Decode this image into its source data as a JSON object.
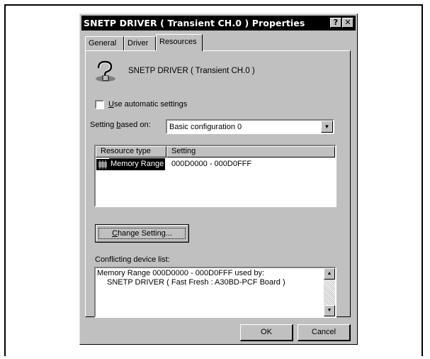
{
  "dialog": {
    "title": "SNETP DRIVER ( Transient CH.0 ) Properties",
    "help_label": "?",
    "close_label": "✕"
  },
  "tabs": [
    {
      "label": "General"
    },
    {
      "label": "Driver"
    },
    {
      "label": "Resources"
    }
  ],
  "device": {
    "icon": "unknown-device-icon",
    "name": "SNETP DRIVER ( Transient CH.0 )"
  },
  "auto_settings": {
    "label_hotkey": "U",
    "label_rest": "se automatic settings",
    "checked": false
  },
  "setting_based": {
    "label_prefix": "Setting ",
    "label_hotkey": "b",
    "label_rest": "ased on:",
    "value": "Basic configuration 0"
  },
  "resources": {
    "columns": [
      "Resource type",
      "Setting"
    ],
    "rows": [
      {
        "type": "Memory Range",
        "setting": "000D0000 - 000D0FFF",
        "icon": "memory-chip-icon"
      }
    ]
  },
  "change_setting": {
    "label_hotkey": "C",
    "label_rest": "hange Setting..."
  },
  "conflicts": {
    "label": "Conflicting device list:",
    "line1": "Memory Range 000D0000 - 000D0FFF used by:",
    "line2": "SNETP DRIVER ( Fast Fresh : A30BD-PCF Board )"
  },
  "buttons": {
    "ok": "OK",
    "cancel": "Cancel"
  }
}
